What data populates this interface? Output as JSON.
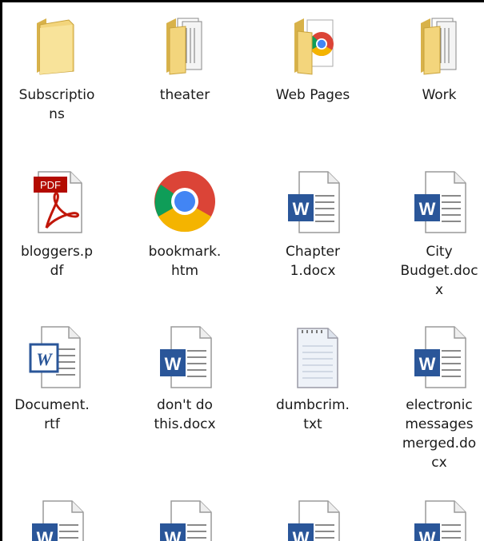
{
  "files": [
    {
      "name": "Subscriptio\nns",
      "type": "folder",
      "icon": "folder-icon"
    },
    {
      "name": "theater",
      "type": "folder",
      "icon": "folder-documents-icon"
    },
    {
      "name": "Web Pages",
      "type": "folder",
      "icon": "folder-chrome-icon"
    },
    {
      "name": "Work",
      "type": "folder",
      "icon": "folder-documents-icon"
    },
    {
      "name": "bloggers.p\ndf",
      "type": "pdf",
      "icon": "pdf-icon"
    },
    {
      "name": "bookmark.\nhtm",
      "type": "htm",
      "icon": "chrome-icon"
    },
    {
      "name": "Chapter\n1.docx",
      "type": "docx",
      "icon": "word-doc-icon"
    },
    {
      "name": "City\nBudget.doc\nx",
      "type": "docx",
      "icon": "word-doc-icon"
    },
    {
      "name": "Document.\nrtf",
      "type": "rtf",
      "icon": "wordpad-doc-icon"
    },
    {
      "name": "don't do\nthis.docx",
      "type": "docx",
      "icon": "word-doc-icon"
    },
    {
      "name": "dumbcrim.\ntxt",
      "type": "txt",
      "icon": "text-file-icon"
    },
    {
      "name": "electronic\nmessages\nmerged.do\ncx",
      "type": "docx",
      "icon": "word-doc-icon"
    },
    {
      "name": "",
      "type": "docx",
      "icon": "word-doc-icon"
    },
    {
      "name": "",
      "type": "docx",
      "icon": "word-doc-icon"
    },
    {
      "name": "",
      "type": "docx",
      "icon": "word-doc-icon"
    },
    {
      "name": "",
      "type": "docx",
      "icon": "word-doc-icon"
    }
  ]
}
